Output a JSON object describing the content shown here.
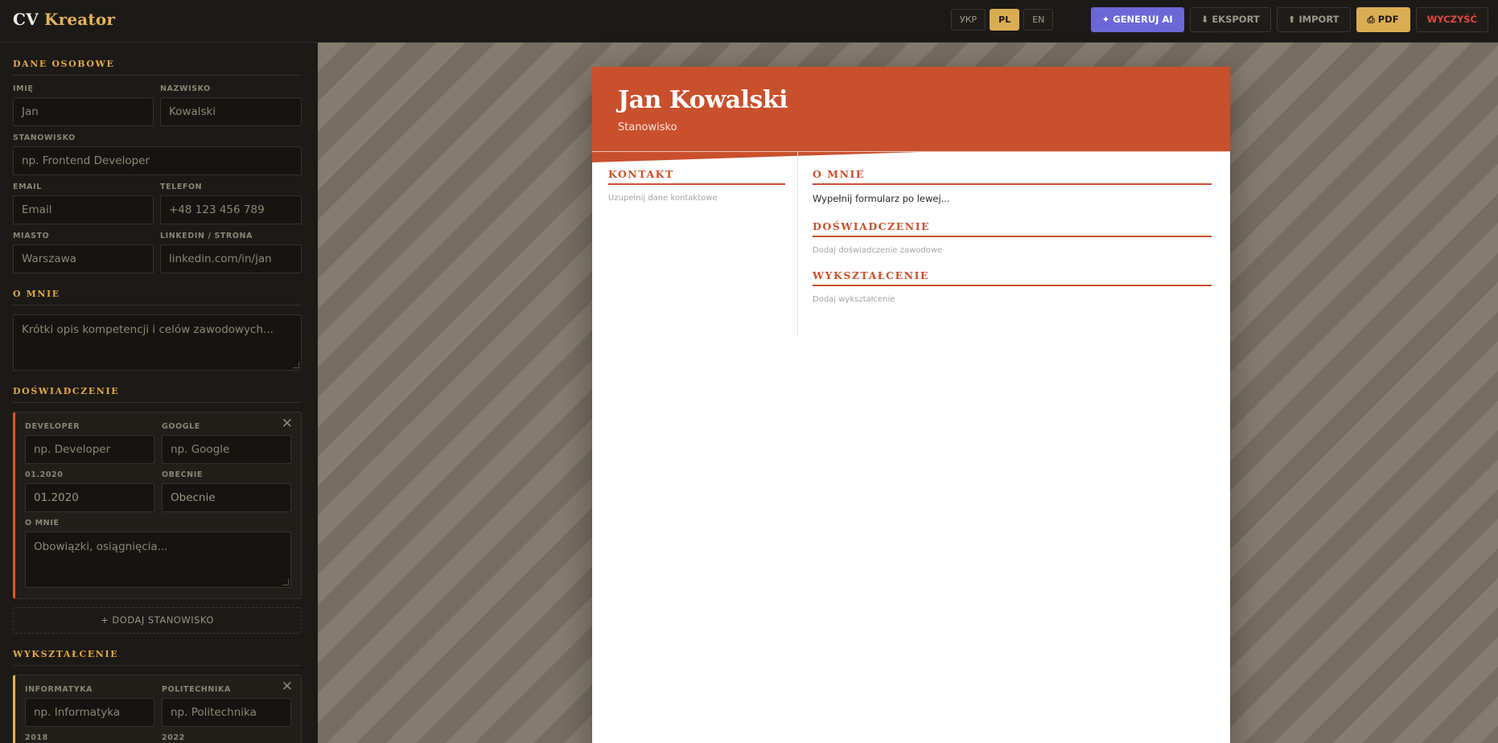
{
  "app": {
    "logo_main": "CV",
    "logo_accent": "Kreator"
  },
  "languages": [
    {
      "label": "УКР",
      "active": false
    },
    {
      "label": "PL",
      "active": true
    },
    {
      "label": "EN",
      "active": false
    }
  ],
  "toolbar": {
    "generate_ai": "✦ GENERUJ AI",
    "export": "⬇ EKSPORT",
    "import": "⬆ IMPORT",
    "pdf": "⎙ PDF",
    "clear": "WYCZYŚĆ"
  },
  "personal": {
    "title": "DANE OSOBOWE",
    "first_name": {
      "label": "IMIĘ",
      "placeholder": "Jan"
    },
    "last_name": {
      "label": "NAZWISKO",
      "placeholder": "Kowalski"
    },
    "position": {
      "label": "STANOWISKO",
      "placeholder": "np. Frontend Developer"
    },
    "email": {
      "label": "EMAIL",
      "placeholder": "Email"
    },
    "phone": {
      "label": "TELEFON",
      "placeholder": "+48 123 456 789"
    },
    "city": {
      "label": "MIASTO",
      "placeholder": "Warszawa"
    },
    "linkedin": {
      "label": "LINKEDIN / STRONA",
      "placeholder": "linkedin.com/in/jan"
    }
  },
  "about": {
    "title": "O MNIE",
    "placeholder": "Krótki opis kompetencji i celów zawodowych..."
  },
  "experience": {
    "title": "DOŚWIADCZENIE",
    "entry": {
      "role_label": "DEVELOPER",
      "role_placeholder": "np. Developer",
      "company_label": "GOOGLE",
      "company_placeholder": "np. Google",
      "start_label": "01.2020",
      "start_placeholder": "01.2020",
      "end_label": "OBECNIE",
      "end_placeholder": "Obecnie",
      "desc_label": "O MNIE",
      "desc_placeholder": "Obowiązki, osiągnięcia..."
    },
    "add_label": "+ DODAJ STANOWISKO"
  },
  "education": {
    "title": "WYKSZTAŁCENIE",
    "entry": {
      "field_label": "INFORMATYKA",
      "field_placeholder": "np. Informatyka",
      "school_label": "POLITECHNIKA",
      "school_placeholder": "np. Politechnika",
      "start_label": "2018",
      "end_label": "2022"
    }
  },
  "cv": {
    "name": "Jan Kowalski",
    "role": "Stanowisko",
    "contact_title": "KONTAKT",
    "contact_empty": "Uzupełnij dane kontaktowe",
    "about_title": "O MNIE",
    "about_text": "Wypełnij formularz po lewej...",
    "experience_title": "DOŚWIADCZENIE",
    "experience_empty": "Dodaj doświadczenie zawodowe",
    "education_title": "WYKSZTAŁCENIE",
    "education_empty": "Dodaj wykształcenie"
  },
  "colors": {
    "accent": "#c9502c",
    "gold": "#e2b357",
    "ai": "#6b67d6",
    "danger": "#e0473b"
  }
}
